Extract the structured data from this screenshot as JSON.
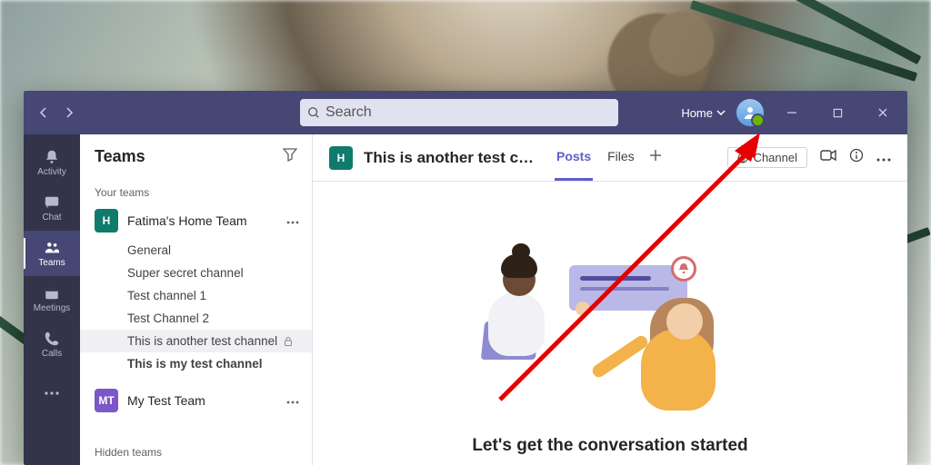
{
  "titlebar": {
    "search_placeholder": "Search",
    "org_label": "Home"
  },
  "rail": {
    "activity": "Activity",
    "chat": "Chat",
    "teams": "Teams",
    "meetings": "Meetings",
    "calls": "Calls"
  },
  "sidebar": {
    "heading": "Teams",
    "your_teams_label": "Your teams",
    "hidden_teams_label": "Hidden teams",
    "team1": {
      "initial": "H",
      "name": "Fatima's Home Team",
      "channels": {
        "c0": "General",
        "c1": "Super secret channel",
        "c2": "Test channel 1",
        "c3": "Test Channel 2",
        "c4": "This is another test channel",
        "c5": "This is my test channel"
      }
    },
    "team2": {
      "initial": "MT",
      "name": "My Test Team"
    }
  },
  "content": {
    "channel_initial": "H",
    "channel_title": "This is another test ch…",
    "tabs": {
      "posts": "Posts",
      "files": "Files"
    },
    "channel_chip": "Channel",
    "empty_title": "Let's get the conversation started"
  }
}
